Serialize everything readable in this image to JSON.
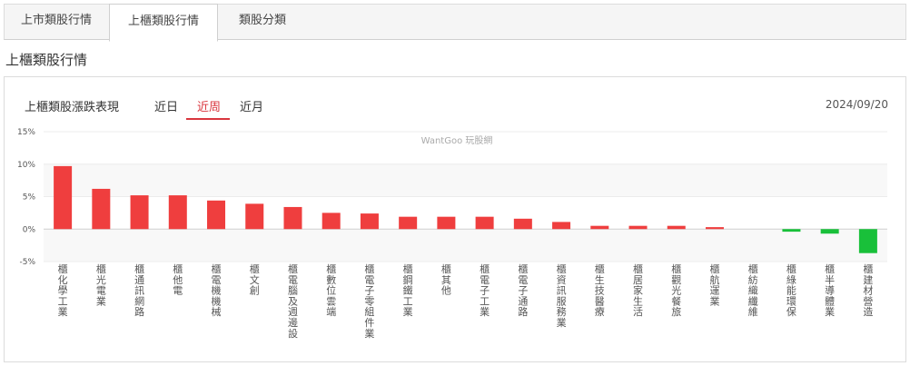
{
  "tabs": [
    {
      "label": "上市類股行情"
    },
    {
      "label": "上櫃類股行情"
    },
    {
      "label": "類股分類"
    }
  ],
  "section_title": "上櫃類股行情",
  "panel": {
    "title": "上櫃類股漲跌表現",
    "periods": [
      {
        "label": "近日"
      },
      {
        "label": "近周"
      },
      {
        "label": "近月"
      }
    ],
    "date": "2024/09/20",
    "watermark": "WantGoo 玩股網"
  },
  "colors": {
    "up": "#ef3e3e",
    "down": "#19c03a",
    "accent": "#d9363e"
  },
  "chart_data": {
    "type": "bar",
    "ylim": [
      -5,
      15
    ],
    "yticks": [
      15,
      10,
      5,
      0,
      -5
    ],
    "ytick_labels": [
      "15%",
      "10%",
      "5%",
      "0%",
      "-5%"
    ],
    "categories": [
      "櫃化學工業",
      "櫃光電業",
      "櫃通訊網路",
      "櫃他電",
      "櫃電機機械",
      "櫃文創",
      "櫃電腦及週邊設",
      "櫃數位雲端",
      "櫃電子零組件業",
      "櫃鋼鐵工業",
      "櫃其他",
      "櫃電子工業",
      "櫃電子通路",
      "櫃資訊服務業",
      "櫃生技醫療",
      "櫃居家生活",
      "櫃觀光餐旅",
      "櫃航運業",
      "櫃紡織纖維",
      "櫃綠能環保",
      "櫃半導體業",
      "櫃建材營造"
    ],
    "values": [
      9.7,
      6.2,
      5.2,
      5.2,
      4.4,
      3.9,
      3.4,
      2.5,
      2.4,
      1.9,
      1.9,
      1.9,
      1.6,
      1.1,
      0.5,
      0.5,
      0.5,
      0.3,
      0.0,
      -0.4,
      -0.7,
      -3.7
    ]
  }
}
